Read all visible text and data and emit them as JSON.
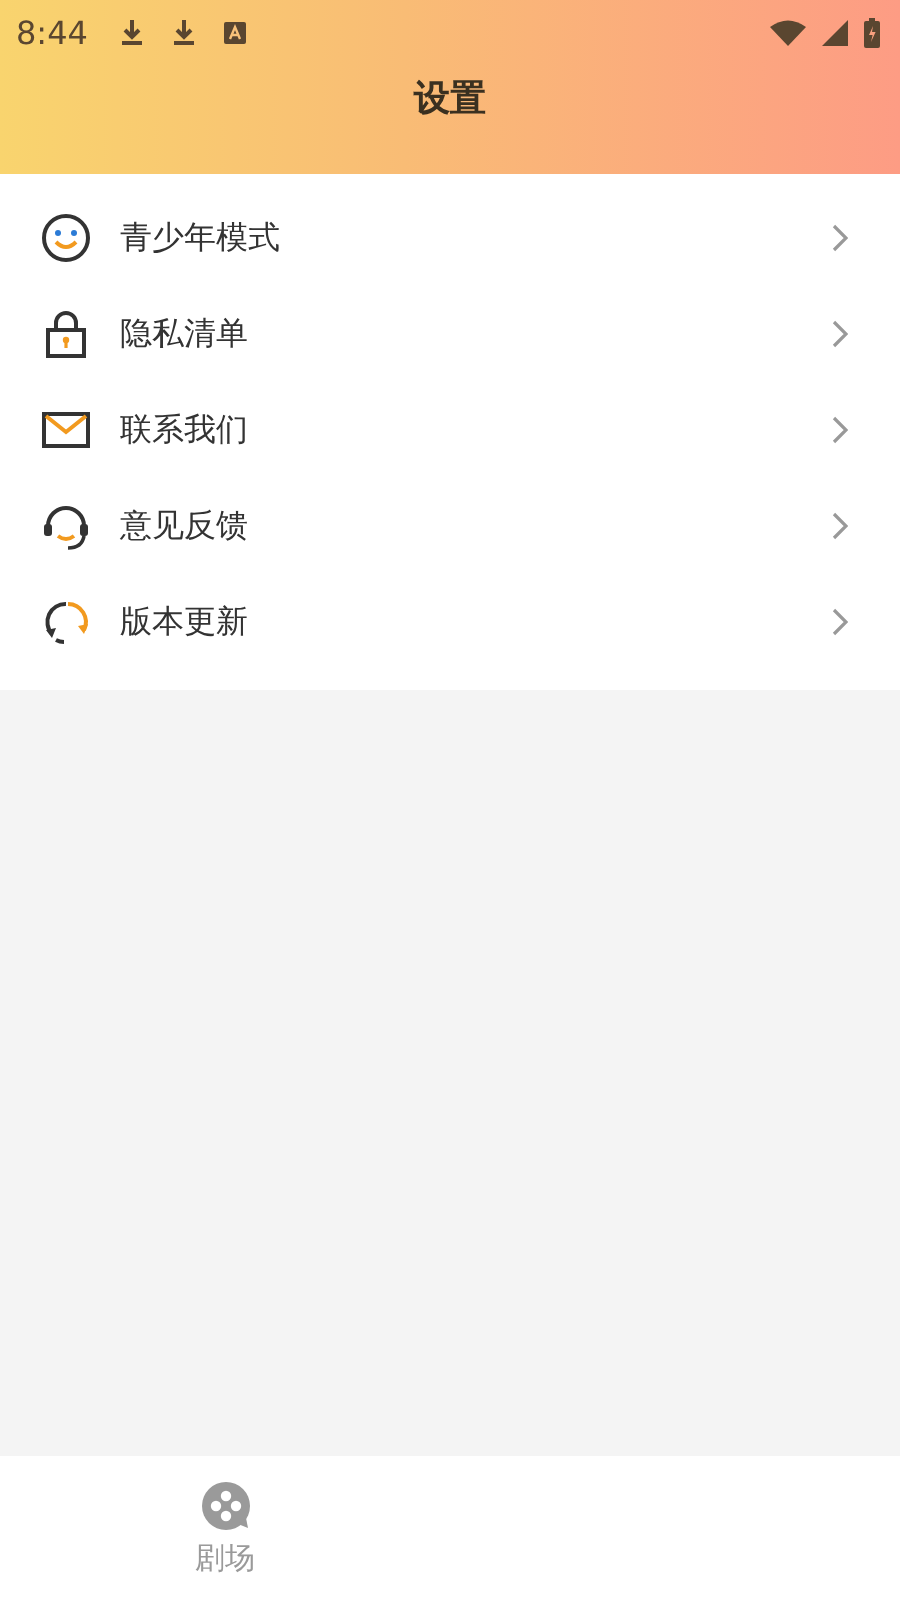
{
  "status_bar": {
    "time": "8:44"
  },
  "header": {
    "title": "设置"
  },
  "settings": [
    {
      "label": "青少年模式",
      "kind": "smile"
    },
    {
      "label": "隐私清单",
      "kind": "lock"
    },
    {
      "label": "联系我们",
      "kind": "mail"
    },
    {
      "label": "意见反馈",
      "kind": "headset"
    },
    {
      "label": "版本更新",
      "kind": "refresh"
    }
  ],
  "bottom_tabs": [
    {
      "label": "剧场",
      "selected": false
    }
  ]
}
